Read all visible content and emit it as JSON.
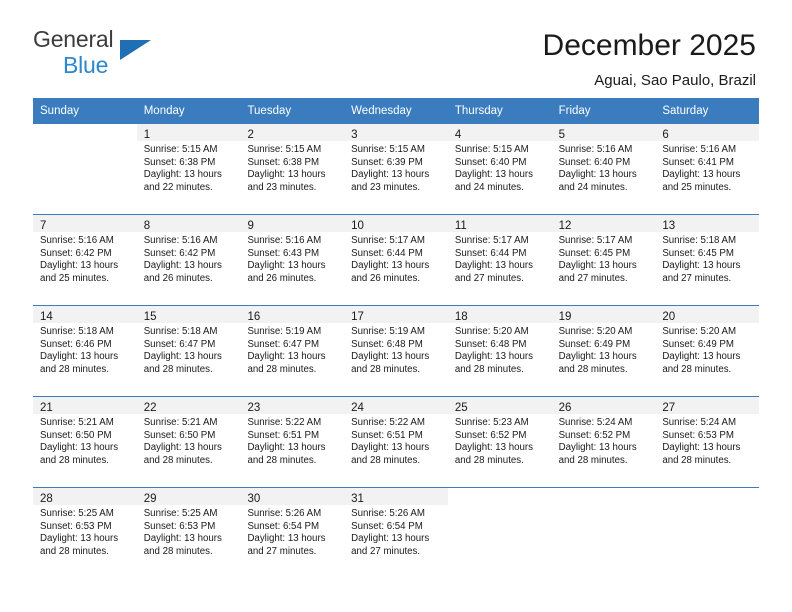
{
  "brand": {
    "name_top": "General",
    "name_bottom": "Blue",
    "triangle_color": "#1f6fb5",
    "blue_color": "#2a87d0"
  },
  "header": {
    "title": "December 2025",
    "location": "Aguai, Sao Paulo, Brazil"
  },
  "theme": {
    "header_blue": "#3a7cbe",
    "daynum_band": "#f2f2f2",
    "text": "#1a1a1a"
  },
  "weekdays": [
    "Sunday",
    "Monday",
    "Tuesday",
    "Wednesday",
    "Thursday",
    "Friday",
    "Saturday"
  ],
  "weeks": [
    [
      {
        "day": "",
        "sunrise": "",
        "sunset": "",
        "daylight1": "",
        "daylight2": ""
      },
      {
        "day": "1",
        "sunrise": "Sunrise: 5:15 AM",
        "sunset": "Sunset: 6:38 PM",
        "daylight1": "Daylight: 13 hours",
        "daylight2": "and 22 minutes."
      },
      {
        "day": "2",
        "sunrise": "Sunrise: 5:15 AM",
        "sunset": "Sunset: 6:38 PM",
        "daylight1": "Daylight: 13 hours",
        "daylight2": "and 23 minutes."
      },
      {
        "day": "3",
        "sunrise": "Sunrise: 5:15 AM",
        "sunset": "Sunset: 6:39 PM",
        "daylight1": "Daylight: 13 hours",
        "daylight2": "and 23 minutes."
      },
      {
        "day": "4",
        "sunrise": "Sunrise: 5:15 AM",
        "sunset": "Sunset: 6:40 PM",
        "daylight1": "Daylight: 13 hours",
        "daylight2": "and 24 minutes."
      },
      {
        "day": "5",
        "sunrise": "Sunrise: 5:16 AM",
        "sunset": "Sunset: 6:40 PM",
        "daylight1": "Daylight: 13 hours",
        "daylight2": "and 24 minutes."
      },
      {
        "day": "6",
        "sunrise": "Sunrise: 5:16 AM",
        "sunset": "Sunset: 6:41 PM",
        "daylight1": "Daylight: 13 hours",
        "daylight2": "and 25 minutes."
      }
    ],
    [
      {
        "day": "7",
        "sunrise": "Sunrise: 5:16 AM",
        "sunset": "Sunset: 6:42 PM",
        "daylight1": "Daylight: 13 hours",
        "daylight2": "and 25 minutes."
      },
      {
        "day": "8",
        "sunrise": "Sunrise: 5:16 AM",
        "sunset": "Sunset: 6:42 PM",
        "daylight1": "Daylight: 13 hours",
        "daylight2": "and 26 minutes."
      },
      {
        "day": "9",
        "sunrise": "Sunrise: 5:16 AM",
        "sunset": "Sunset: 6:43 PM",
        "daylight1": "Daylight: 13 hours",
        "daylight2": "and 26 minutes."
      },
      {
        "day": "10",
        "sunrise": "Sunrise: 5:17 AM",
        "sunset": "Sunset: 6:44 PM",
        "daylight1": "Daylight: 13 hours",
        "daylight2": "and 26 minutes."
      },
      {
        "day": "11",
        "sunrise": "Sunrise: 5:17 AM",
        "sunset": "Sunset: 6:44 PM",
        "daylight1": "Daylight: 13 hours",
        "daylight2": "and 27 minutes."
      },
      {
        "day": "12",
        "sunrise": "Sunrise: 5:17 AM",
        "sunset": "Sunset: 6:45 PM",
        "daylight1": "Daylight: 13 hours",
        "daylight2": "and 27 minutes."
      },
      {
        "day": "13",
        "sunrise": "Sunrise: 5:18 AM",
        "sunset": "Sunset: 6:45 PM",
        "daylight1": "Daylight: 13 hours",
        "daylight2": "and 27 minutes."
      }
    ],
    [
      {
        "day": "14",
        "sunrise": "Sunrise: 5:18 AM",
        "sunset": "Sunset: 6:46 PM",
        "daylight1": "Daylight: 13 hours",
        "daylight2": "and 28 minutes."
      },
      {
        "day": "15",
        "sunrise": "Sunrise: 5:18 AM",
        "sunset": "Sunset: 6:47 PM",
        "daylight1": "Daylight: 13 hours",
        "daylight2": "and 28 minutes."
      },
      {
        "day": "16",
        "sunrise": "Sunrise: 5:19 AM",
        "sunset": "Sunset: 6:47 PM",
        "daylight1": "Daylight: 13 hours",
        "daylight2": "and 28 minutes."
      },
      {
        "day": "17",
        "sunrise": "Sunrise: 5:19 AM",
        "sunset": "Sunset: 6:48 PM",
        "daylight1": "Daylight: 13 hours",
        "daylight2": "and 28 minutes."
      },
      {
        "day": "18",
        "sunrise": "Sunrise: 5:20 AM",
        "sunset": "Sunset: 6:48 PM",
        "daylight1": "Daylight: 13 hours",
        "daylight2": "and 28 minutes."
      },
      {
        "day": "19",
        "sunrise": "Sunrise: 5:20 AM",
        "sunset": "Sunset: 6:49 PM",
        "daylight1": "Daylight: 13 hours",
        "daylight2": "and 28 minutes."
      },
      {
        "day": "20",
        "sunrise": "Sunrise: 5:20 AM",
        "sunset": "Sunset: 6:49 PM",
        "daylight1": "Daylight: 13 hours",
        "daylight2": "and 28 minutes."
      }
    ],
    [
      {
        "day": "21",
        "sunrise": "Sunrise: 5:21 AM",
        "sunset": "Sunset: 6:50 PM",
        "daylight1": "Daylight: 13 hours",
        "daylight2": "and 28 minutes."
      },
      {
        "day": "22",
        "sunrise": "Sunrise: 5:21 AM",
        "sunset": "Sunset: 6:50 PM",
        "daylight1": "Daylight: 13 hours",
        "daylight2": "and 28 minutes."
      },
      {
        "day": "23",
        "sunrise": "Sunrise: 5:22 AM",
        "sunset": "Sunset: 6:51 PM",
        "daylight1": "Daylight: 13 hours",
        "daylight2": "and 28 minutes."
      },
      {
        "day": "24",
        "sunrise": "Sunrise: 5:22 AM",
        "sunset": "Sunset: 6:51 PM",
        "daylight1": "Daylight: 13 hours",
        "daylight2": "and 28 minutes."
      },
      {
        "day": "25",
        "sunrise": "Sunrise: 5:23 AM",
        "sunset": "Sunset: 6:52 PM",
        "daylight1": "Daylight: 13 hours",
        "daylight2": "and 28 minutes."
      },
      {
        "day": "26",
        "sunrise": "Sunrise: 5:24 AM",
        "sunset": "Sunset: 6:52 PM",
        "daylight1": "Daylight: 13 hours",
        "daylight2": "and 28 minutes."
      },
      {
        "day": "27",
        "sunrise": "Sunrise: 5:24 AM",
        "sunset": "Sunset: 6:53 PM",
        "daylight1": "Daylight: 13 hours",
        "daylight2": "and 28 minutes."
      }
    ],
    [
      {
        "day": "28",
        "sunrise": "Sunrise: 5:25 AM",
        "sunset": "Sunset: 6:53 PM",
        "daylight1": "Daylight: 13 hours",
        "daylight2": "and 28 minutes."
      },
      {
        "day": "29",
        "sunrise": "Sunrise: 5:25 AM",
        "sunset": "Sunset: 6:53 PM",
        "daylight1": "Daylight: 13 hours",
        "daylight2": "and 28 minutes."
      },
      {
        "day": "30",
        "sunrise": "Sunrise: 5:26 AM",
        "sunset": "Sunset: 6:54 PM",
        "daylight1": "Daylight: 13 hours",
        "daylight2": "and 27 minutes."
      },
      {
        "day": "31",
        "sunrise": "Sunrise: 5:26 AM",
        "sunset": "Sunset: 6:54 PM",
        "daylight1": "Daylight: 13 hours",
        "daylight2": "and 27 minutes."
      },
      {
        "day": "",
        "sunrise": "",
        "sunset": "",
        "daylight1": "",
        "daylight2": ""
      },
      {
        "day": "",
        "sunrise": "",
        "sunset": "",
        "daylight1": "",
        "daylight2": ""
      },
      {
        "day": "",
        "sunrise": "",
        "sunset": "",
        "daylight1": "",
        "daylight2": ""
      }
    ]
  ]
}
